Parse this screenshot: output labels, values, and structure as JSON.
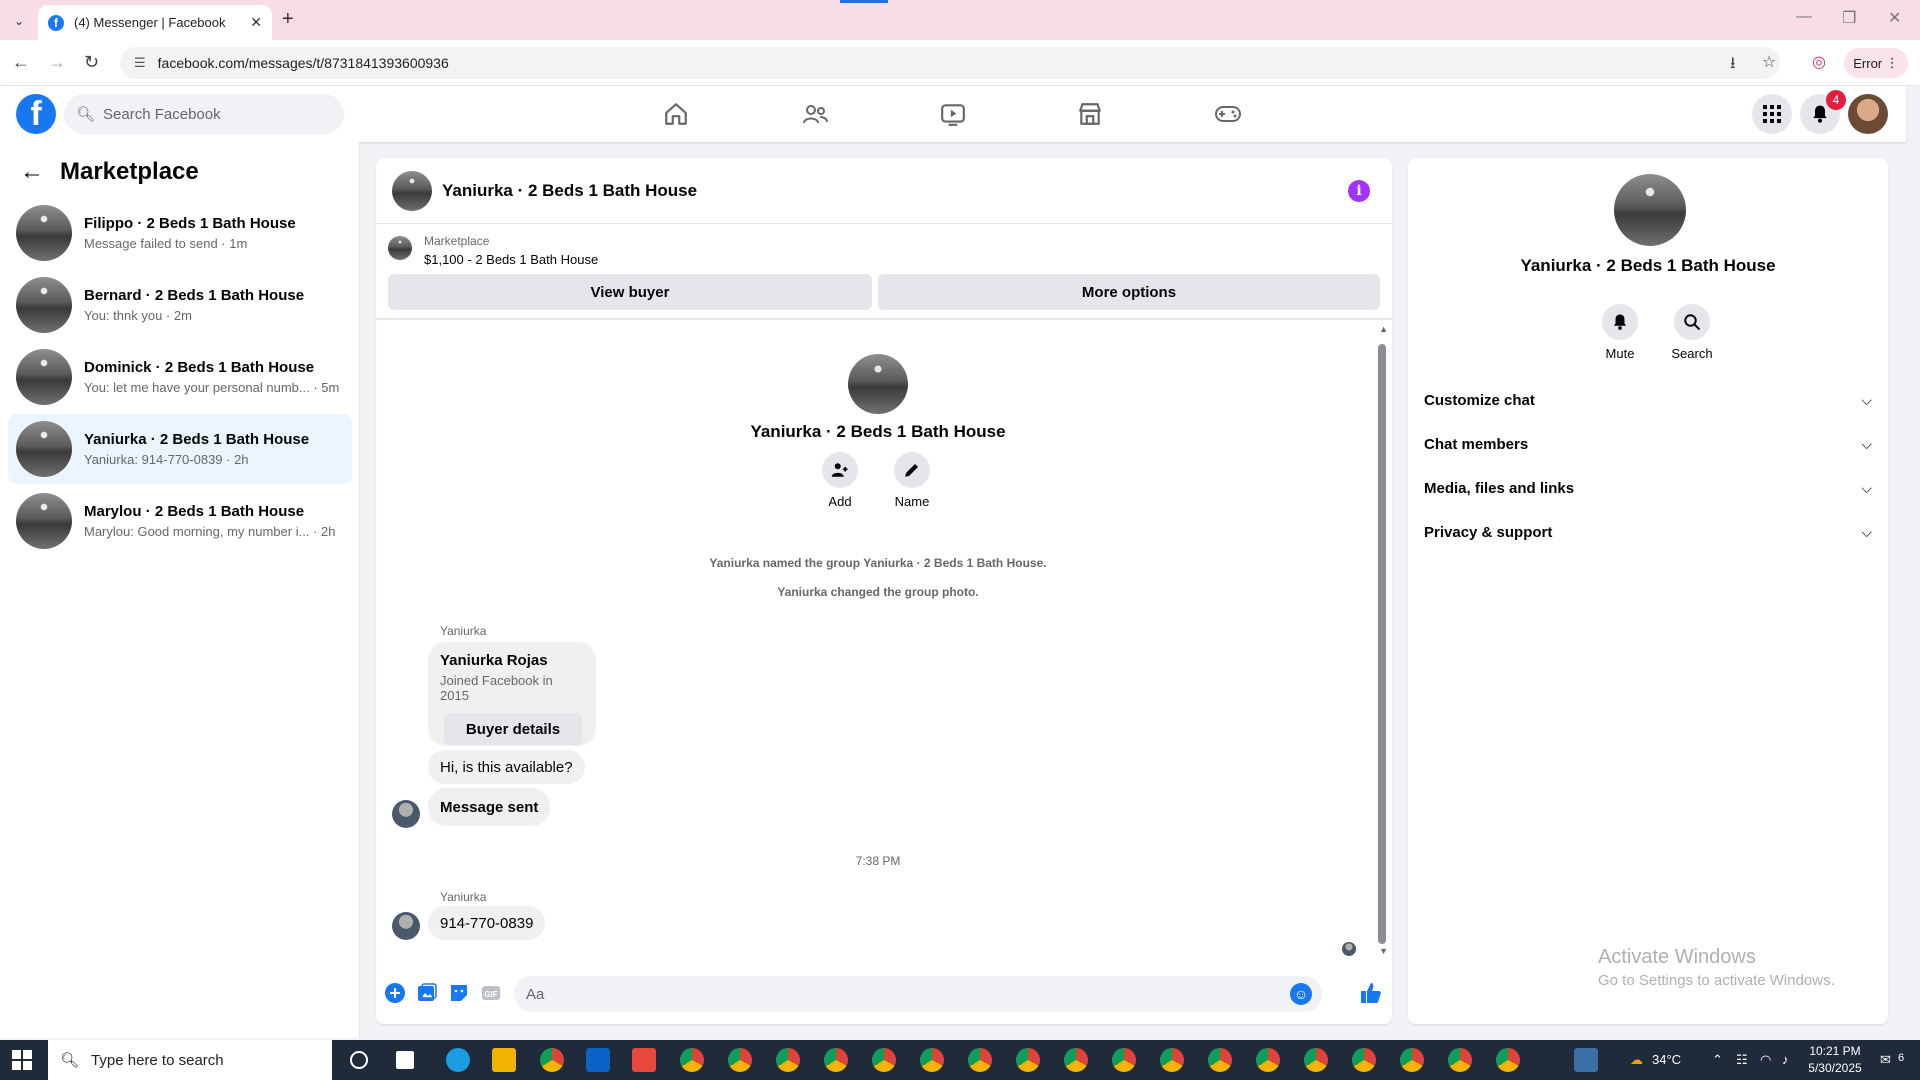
{
  "browser": {
    "tab_title": "(4) Messenger | Facebook",
    "url": "facebook.com/messages/t/8731841393600936",
    "error_label": "Error"
  },
  "header": {
    "search_placeholder": "Search Facebook",
    "notification_count": "4"
  },
  "sidebar": {
    "title": "Marketplace",
    "conversations": [
      {
        "name": "Filippo · 2 Beds 1 Bath House",
        "preview": "Message failed to send · 1m"
      },
      {
        "name": "Bernard · 2 Beds 1 Bath House",
        "preview": "You: thnk you · 2m"
      },
      {
        "name": "Dominick · 2 Beds 1 Bath House",
        "preview": "You: let me have your personal numb...  · 5m"
      },
      {
        "name": "Yaniurka · 2 Beds 1 Bath House",
        "preview": "Yaniurka: 914-770-0839 · 2h"
      },
      {
        "name": "Marylou · 2 Beds 1 Bath House",
        "preview": "Marylou: Good morning, my number i... · 2h"
      }
    ]
  },
  "chat": {
    "title": "Yaniurka · 2 Beds 1 Bath House",
    "marketplace_label": "Marketplace",
    "listing": "$1,100 - 2 Beds 1 Bath House",
    "view_buyer": "View buyer",
    "more_options": "More options",
    "center_name": "Yaniurka · 2 Beds 1 Bath House",
    "add_label": "Add",
    "name_label": "Name",
    "system_msgs": [
      "Yaniurka named the group Yaniurka · 2 Beds 1 Bath House.",
      "Yaniurka changed the group photo."
    ],
    "sender": "Yaniurka",
    "card": {
      "name": "Yaniurka Rojas",
      "sub": "Joined Facebook in 2015",
      "button": "Buyer details"
    },
    "msg1": "Hi, is this available?",
    "msg2": "Message sent",
    "time": "7:38 PM",
    "sender2": "Yaniurka",
    "msg3": "914-770-0839",
    "composer_placeholder": "Aa"
  },
  "info_panel": {
    "name": "Yaniurka · 2 Beds 1 Bath House",
    "mute": "Mute",
    "search": "Search",
    "sections": [
      "Customize chat",
      "Chat members",
      "Media, files and links",
      "Privacy & support"
    ]
  },
  "watermark": {
    "line1": "Activate Windows",
    "line2": "Go to Settings to activate Windows."
  },
  "taskbar": {
    "search_text": "Type here to search",
    "temperature": "34°C",
    "time": "10:21 PM",
    "date": "5/30/2025",
    "notif_count": "6"
  }
}
